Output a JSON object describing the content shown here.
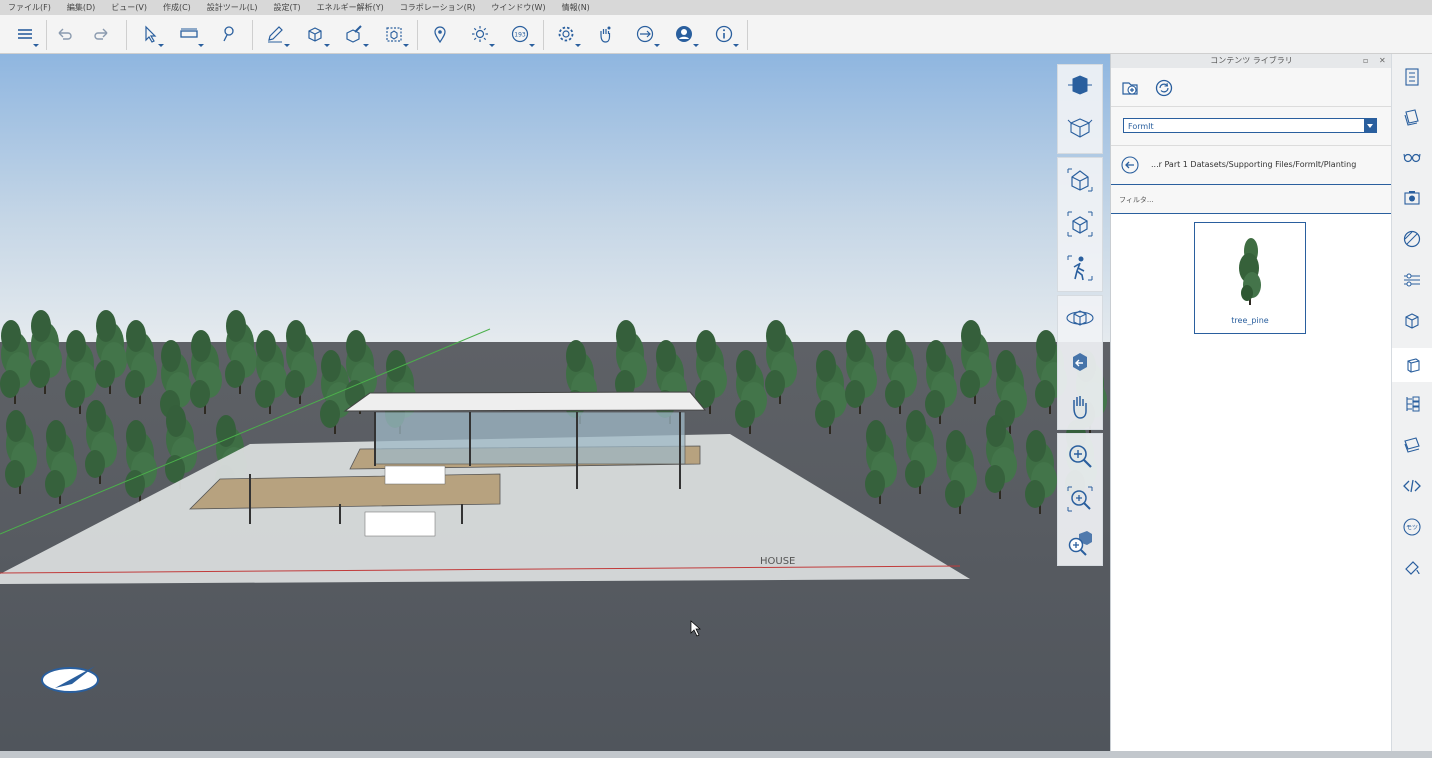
{
  "menubar": {
    "items": [
      "ファイル(F)",
      "編集(D)",
      "ビュー(V)",
      "作成(C)",
      "設計ツール(L)",
      "設定(T)",
      "エネルギー解析(Y)",
      "コラボレーション(R)",
      "ウインドウ(W)",
      "情報(N)"
    ]
  },
  "toolbar": {
    "icons": [
      "layers-menu-icon",
      "undo-icon",
      "redo-icon",
      "select-icon",
      "measure-icon",
      "tape-icon",
      "sketch-pencil-icon",
      "primitives-cube-icon",
      "modify-icon",
      "group-icon",
      "location-pin-icon",
      "sun-icon",
      "compass-193-icon",
      "settings-gear-icon",
      "hand-grab-icon",
      "share-icon",
      "account-icon",
      "info-icon"
    ],
    "compass_value": "193"
  },
  "navigation": {
    "group1": [
      "view-cube-front-icon",
      "view-cube-wire-icon"
    ],
    "group2": [
      "home-view-icon",
      "fit-view-icon",
      "walk-figure-icon"
    ],
    "group3": [
      "orbit-icon",
      "look-around-icon",
      "pan-hand-icon"
    ],
    "group4": [
      "zoom-in-icon",
      "zoom-window-icon",
      "zoom-extents-icon"
    ]
  },
  "panel": {
    "title": "コンテンツ ライブラリ",
    "source_selected": "FormIt",
    "path": "...r Part 1 Datasets/Supporting Files/FormIt/Planting",
    "filter_placeholder": "フィルタ...",
    "items": [
      {
        "label": "tree_pine"
      }
    ]
  },
  "rail": {
    "icons": [
      "properties-icon",
      "layers-stack-icon",
      "visual-styles-glasses-icon",
      "scenes-camera-icon",
      "materials-icon",
      "levels-icon",
      "groups-icon",
      "content-library-icon",
      "layers-tree-icon",
      "scenes-stack-icon",
      "code-icon",
      "moments-icon",
      "paint-icon"
    ],
    "moments_label": "モツ"
  },
  "colors": {
    "accent": "#2a5f9e",
    "sky_top": "#8fb6e0",
    "sky_horizon": "#e8ecef",
    "ground": "#5a6068"
  }
}
